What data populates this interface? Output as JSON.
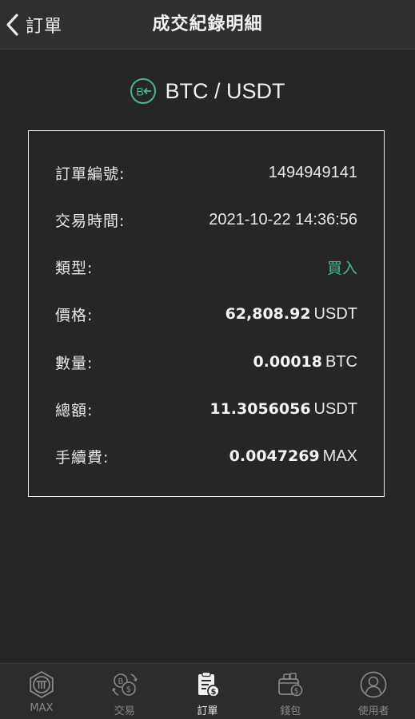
{
  "header": {
    "back_label": "訂單",
    "title": "成交紀錄明細"
  },
  "pair": {
    "label": "BTC / USDT",
    "icon": "btc-coin-icon",
    "icon_color": "#4fb591"
  },
  "details": {
    "order_id": {
      "label": "訂單編號:",
      "value": "1494949141"
    },
    "trade_time": {
      "label": "交易時間:",
      "value": "2021-10-22 14:36:56"
    },
    "type": {
      "label": "類型:",
      "value": "買入",
      "color": "#4fb591"
    },
    "price": {
      "label": "價格:",
      "value": "62,808.92",
      "unit": "USDT"
    },
    "quantity": {
      "label": "數量:",
      "value": "0.00018",
      "unit": "BTC"
    },
    "total": {
      "label": "總額:",
      "value": "11.3056056",
      "unit": "USDT"
    },
    "fee": {
      "label": "手續費:",
      "value": "0.0047269",
      "unit": "MAX"
    }
  },
  "tabbar": {
    "active": "orders",
    "items": [
      {
        "id": "max",
        "label": "MAX",
        "icon": "max-logo-icon"
      },
      {
        "id": "trade",
        "label": "交易",
        "icon": "exchange-icon"
      },
      {
        "id": "orders",
        "label": "訂單",
        "icon": "orders-clipboard-icon"
      },
      {
        "id": "wallet",
        "label": "錢包",
        "icon": "wallet-icon"
      },
      {
        "id": "user",
        "label": "使用者",
        "icon": "user-icon"
      }
    ]
  }
}
